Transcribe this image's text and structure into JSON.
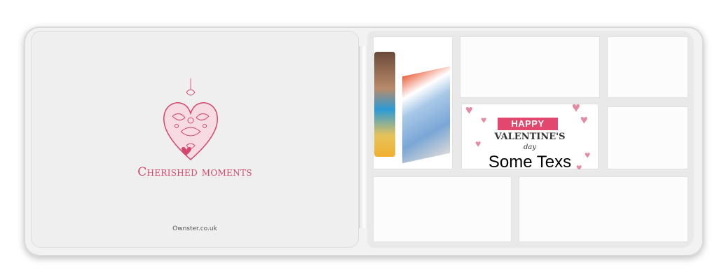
{
  "wallet": {
    "left_page": {
      "tagline": "Cherished moments",
      "website": "Ownster.co.uk",
      "icon": "filigree-heart-icon"
    },
    "right_page": {
      "slots": [
        "photo-card",
        "empty",
        "empty",
        "valentine-card",
        "empty",
        "empty",
        "empty"
      ],
      "valentine_card": {
        "banner": "HAPPY",
        "title": "VALENTINE'S",
        "subtitle": "day",
        "custom_text": "Some Texs"
      }
    }
  },
  "colors": {
    "accent": "#d6456c",
    "banner": "#e2476d",
    "light_heart": "#e58aa3"
  }
}
